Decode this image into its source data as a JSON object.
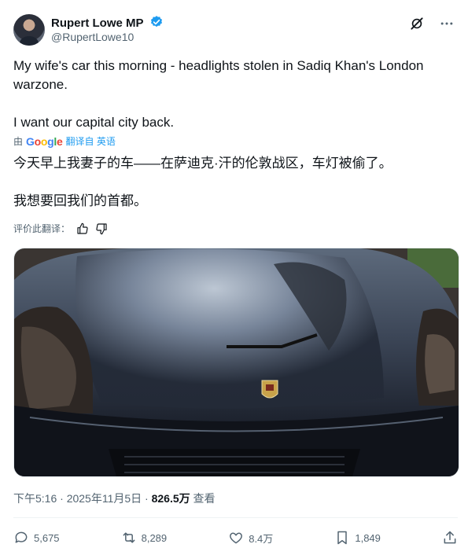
{
  "author": {
    "name": "Rupert Lowe MP",
    "handle": "@RupertLowe10"
  },
  "tweet": {
    "text_line1": "My wife's car this morning - headlights stolen in Sadiq Khan's London warzone.",
    "text_line2": "I want our capital city back.",
    "translate_prefix": "由",
    "translate_brand": "Google",
    "translate_label": "翻译自 英语",
    "translation_line1": "今天早上我妻子的车——在萨迪克·汗的伦敦战区，车灯被偷了。",
    "translation_line2": "我想要回我们的首都。",
    "rate_label": "评价此翻译："
  },
  "meta": {
    "timestamp": "下午5:16 · 2025年11月5日 · ",
    "views": "826.5万",
    "views_label": " 查看"
  },
  "actions": {
    "replies": "5,675",
    "retweets": "8,289",
    "likes": "8.4万",
    "bookmarks": "1,849"
  },
  "colors": {
    "verified": "#1d9bf0",
    "link": "#1d9bf0",
    "secondary": "#536471"
  },
  "icons": [
    "verified-badge-icon",
    "grok-icon",
    "more-icon",
    "thumbs-up-icon",
    "thumbs-down-icon",
    "reply-icon",
    "retweet-icon",
    "like-icon",
    "bookmark-icon",
    "share-icon"
  ]
}
